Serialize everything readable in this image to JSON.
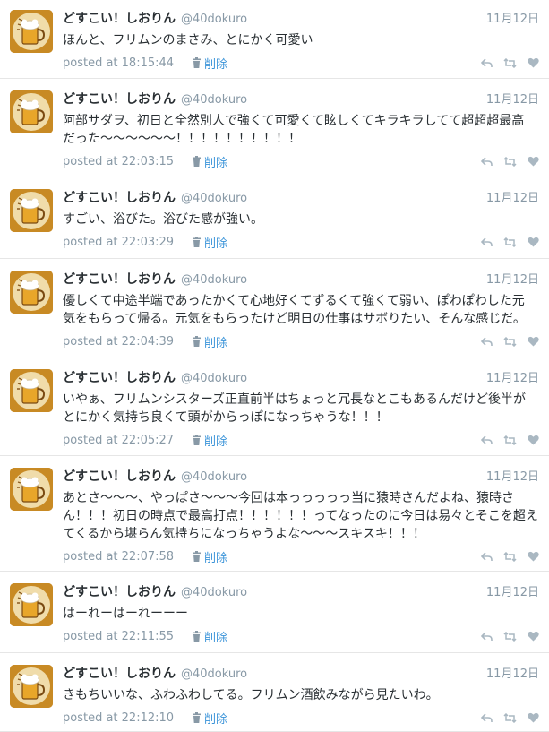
{
  "delete_label": "削除",
  "tweets": [
    {
      "name": "どすこい！しおりん",
      "handle": "@40dokuro",
      "date": "11月12日",
      "text": [
        "ほんと、フリムンのまさみ、とにかく可愛い"
      ],
      "posted": "posted at 18:15:44"
    },
    {
      "name": "どすこい！しおりん",
      "handle": "@40dokuro",
      "date": "11月12日",
      "text": [
        "阿部サダヲ、初日と全然別人で強くて可愛くて眩しくてキラキラしてて超超超最高",
        "だった〜〜〜〜〜〜！！！！！！！！！！"
      ],
      "posted": "posted at 22:03:15"
    },
    {
      "name": "どすこい！しおりん",
      "handle": "@40dokuro",
      "date": "11月12日",
      "text": [
        "すごい、浴びた。浴びた感が強い。"
      ],
      "posted": "posted at 22:03:29"
    },
    {
      "name": "どすこい！しおりん",
      "handle": "@40dokuro",
      "date": "11月12日",
      "text": [
        "優しくて中途半端であったかくて心地好くてずるくて強くて弱い、ぽわぽわした元",
        "気をもらって帰る。元気をもらったけど明日の仕事はサボりたい、そんな感じだ。"
      ],
      "posted": "posted at 22:04:39"
    },
    {
      "name": "どすこい！しおりん",
      "handle": "@40dokuro",
      "date": "11月12日",
      "text": [
        "いやぁ、フリムンシスターズ正直前半はちょっと冗長なとこもあるんだけど後半が",
        "とにかく気持ち良くて頭がからっぽになっちゃうな！！！"
      ],
      "posted": "posted at 22:05:27"
    },
    {
      "name": "どすこい！しおりん",
      "handle": "@40dokuro",
      "date": "11月12日",
      "text": [
        "あとさ〜〜〜、やっぱさ〜〜〜今回は本っっっっっ当に猿時さんだよね、猿時さ",
        "ん！！！初日の時点で最高打点！！！！！！ってなったのに今日は易々とそこを超え",
        "てくるから堪らん気持ちになっちゃうよな〜〜〜スキスキ！！！"
      ],
      "posted": "posted at 22:07:58"
    },
    {
      "name": "どすこい！しおりん",
      "handle": "@40dokuro",
      "date": "11月12日",
      "text": [
        "はーれーはーれーーー"
      ],
      "posted": "posted at 22:11:55"
    },
    {
      "name": "どすこい！しおりん",
      "handle": "@40dokuro",
      "date": "11月12日",
      "text": [
        "きもちいいな、ふわふわしてる。フリムン酒飲みながら見たいわ。"
      ],
      "posted": "posted at 22:12:10"
    }
  ]
}
